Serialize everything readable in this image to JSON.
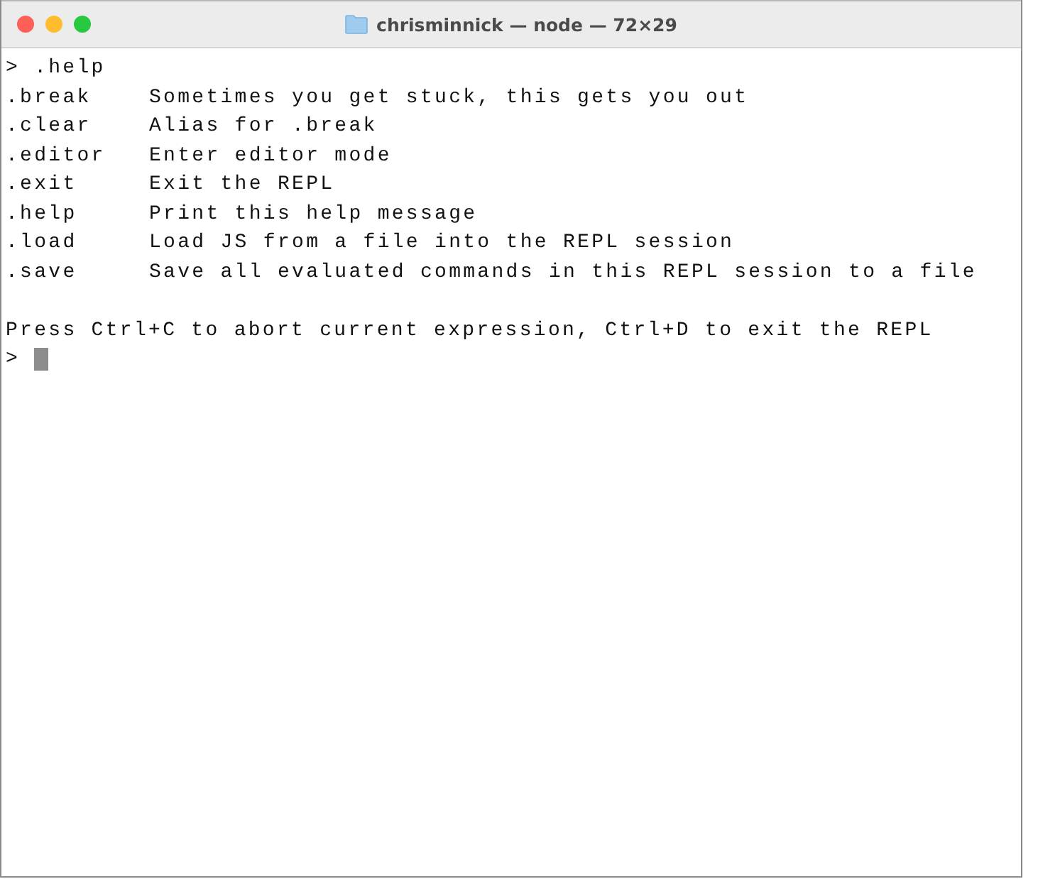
{
  "window": {
    "title": "chrisminnick — node — 72×29"
  },
  "terminal": {
    "input_line": {
      "prompt": ">",
      "command": ".help"
    },
    "commands": [
      {
        "name": ".break",
        "description": "Sometimes you get stuck, this gets you out"
      },
      {
        "name": ".clear",
        "description": "Alias for .break"
      },
      {
        "name": ".editor",
        "description": "Enter editor mode"
      },
      {
        "name": ".exit",
        "description": "Exit the REPL"
      },
      {
        "name": ".help",
        "description": "Print this help message"
      },
      {
        "name": ".load",
        "description": "Load JS from a file into the REPL session"
      },
      {
        "name": ".save",
        "description": "Save all evaluated commands in this REPL session to a file"
      }
    ],
    "footer": "Press Ctrl+C to abort current expression, Ctrl+D to exit the REPL",
    "prompt": ">"
  }
}
